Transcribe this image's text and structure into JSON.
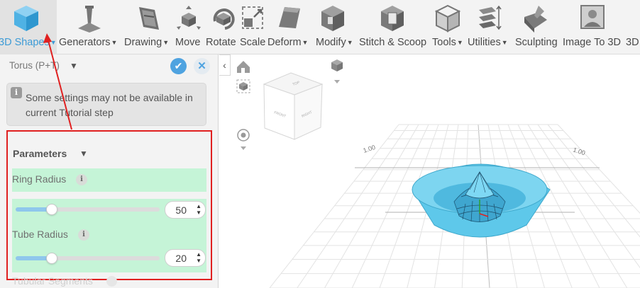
{
  "toolbar": {
    "items": [
      {
        "label": "3D Shapes",
        "dropdown": true,
        "icon": "cube-icon"
      },
      {
        "label": "Generators",
        "dropdown": true,
        "icon": "generator-icon"
      },
      {
        "label": "Drawing",
        "dropdown": true,
        "icon": "drawing-icon"
      },
      {
        "label": "Move",
        "dropdown": false,
        "icon": "move-icon"
      },
      {
        "label": "Rotate",
        "dropdown": false,
        "icon": "rotate-icon"
      },
      {
        "label": "Scale",
        "dropdown": false,
        "icon": "scale-icon"
      },
      {
        "label": "Deform",
        "dropdown": true,
        "icon": "deform-icon"
      },
      {
        "label": "Modify",
        "dropdown": true,
        "icon": "modify-icon"
      },
      {
        "label": "Stitch & Scoop",
        "dropdown": false,
        "icon": "stitch-scoop-icon"
      },
      {
        "label": "Tools",
        "dropdown": true,
        "icon": "tools-icon"
      },
      {
        "label": "Utilities",
        "dropdown": true,
        "icon": "utilities-icon"
      },
      {
        "label": "Sculpting",
        "dropdown": false,
        "icon": "sculpting-icon"
      },
      {
        "label": "Image To 3D",
        "dropdown": false,
        "icon": "image-to-3d-icon"
      },
      {
        "label": "3D",
        "dropdown": false,
        "icon": ""
      }
    ]
  },
  "panel": {
    "title": "Torus (P+T)",
    "confirm_icon": "check-icon",
    "cancel_icon": "close-icon",
    "info_icon_glyph": "i",
    "notice": "Some settings may not be available in current Tutorial step",
    "parameters_title": "Parameters",
    "params": [
      {
        "label": "Ring Radius",
        "value": "50",
        "slider_fraction": 0.25
      },
      {
        "label": "Tube Radius",
        "value": "20",
        "slider_fraction": 0.25
      }
    ],
    "next_param_label": "Tubular Segments"
  },
  "viewport": {
    "view_cube_faces": [
      "TOP",
      "FRONT",
      "RIGHT"
    ],
    "grid_label_left": "1.00",
    "grid_label_right": "1.00",
    "object_color": "#5ec8ea",
    "highlight_color": "#e02020"
  }
}
